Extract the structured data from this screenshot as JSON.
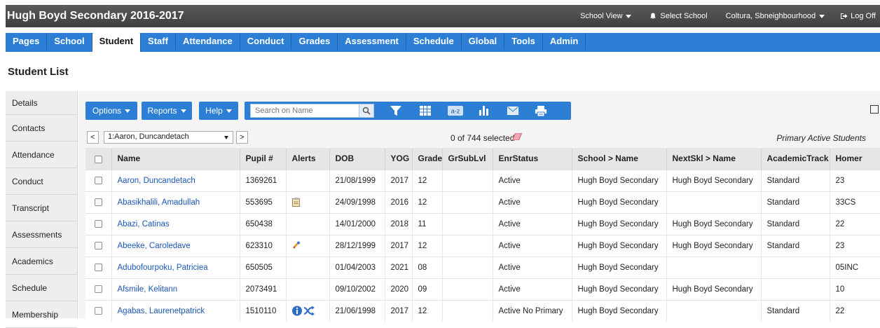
{
  "header": {
    "title": "Hugh Boyd Secondary 2016-2017",
    "school_view": "School View",
    "select_school": "Select School",
    "user": "Coltura, Sbneighbourhood",
    "logoff": "Log Off"
  },
  "nav": {
    "tabs": [
      "Pages",
      "School",
      "Student",
      "Staff",
      "Attendance",
      "Conduct",
      "Grades",
      "Assessment",
      "Schedule",
      "Global",
      "Tools",
      "Admin"
    ],
    "active": "Student"
  },
  "page": {
    "title": "Student List"
  },
  "side_menu": [
    "Details",
    "Contacts",
    "Attendance",
    "Conduct",
    "Transcript",
    "Assessments",
    "Academics",
    "Schedule",
    "Membership"
  ],
  "toolbar": {
    "options": "Options",
    "reports": "Reports",
    "help": "Help",
    "search_placeholder": "Search on Name",
    "icons": [
      "search-icon",
      "filter-icon",
      "grid-icon",
      "sort-az-icon",
      "chart-icon",
      "email-icon",
      "print-icon"
    ]
  },
  "list_nav": {
    "prev": "<",
    "next": ">",
    "current_student": "1:Aaron, Duncandetach",
    "selected": "0 of 744 selected",
    "filter": "Primary Active Students"
  },
  "table": {
    "columns": [
      "Name",
      "Pupil #",
      "Alerts",
      "DOB",
      "YOG",
      "Grade",
      "GrSubLvl",
      "EnrStatus",
      "School > Name",
      "NextSkl > Name",
      "AcademicTrack",
      "Homer"
    ],
    "rows": [
      {
        "name": "Aaron, Duncandetach",
        "pupil": "1369261",
        "alert": "",
        "dob": "21/08/1999",
        "yog": "2017",
        "grade": "12",
        "subl": "",
        "enr": "Active",
        "school": "Hugh Boyd Secondary",
        "next": "Hugh Boyd Secondary",
        "track": "Standard",
        "home": "23"
      },
      {
        "name": "Abasikhalili, Amadullah",
        "pupil": "553695",
        "alert": "notes-icon",
        "dob": "24/09/1998",
        "yog": "2016",
        "grade": "12",
        "subl": "",
        "enr": "Active",
        "school": "Hugh Boyd Secondary",
        "next": "",
        "track": "Standard",
        "home": "33CS"
      },
      {
        "name": "Abazi, Catinas",
        "pupil": "650438",
        "alert": "",
        "dob": "14/01/2000",
        "yog": "2018",
        "grade": "11",
        "subl": "",
        "enr": "Active",
        "school": "Hugh Boyd Secondary",
        "next": "Hugh Boyd Secondary",
        "track": "Standard",
        "home": "22"
      },
      {
        "name": "Abeeke, Caroledave",
        "pupil": "623310",
        "alert": "medical-icon",
        "dob": "28/12/1999",
        "yog": "2017",
        "grade": "12",
        "subl": "",
        "enr": "Active",
        "school": "Hugh Boyd Secondary",
        "next": "Hugh Boyd Secondary",
        "track": "Standard",
        "home": "23"
      },
      {
        "name": "Adubofourpoku, Patriciea",
        "pupil": "650505",
        "alert": "",
        "dob": "01/04/2003",
        "yog": "2021",
        "grade": "08",
        "subl": "",
        "enr": "Active",
        "school": "Hugh Boyd Secondary",
        "next": "",
        "track": "",
        "home": "05INC"
      },
      {
        "name": "Afsmile, Kelitann",
        "pupil": "2073491",
        "alert": "",
        "dob": "09/10/2002",
        "yog": "2020",
        "grade": "09",
        "subl": "",
        "enr": "Active",
        "school": "Hugh Boyd Secondary",
        "next": "Hugh Boyd Secondary",
        "track": "",
        "home": "10"
      },
      {
        "name": "Agabas, Laurenetpatrick",
        "pupil": "1510110",
        "alert": "info-shuffle-icon",
        "dob": "21/06/1998",
        "yog": "2017",
        "grade": "12",
        "subl": "",
        "enr": "Active No Primary",
        "school": "Hugh Boyd Secondary",
        "next": "",
        "track": "Standard",
        "home": "22"
      }
    ]
  },
  "colors": {
    "accent": "#2d7fd6",
    "header": "#474747",
    "link": "#1a56b6"
  }
}
